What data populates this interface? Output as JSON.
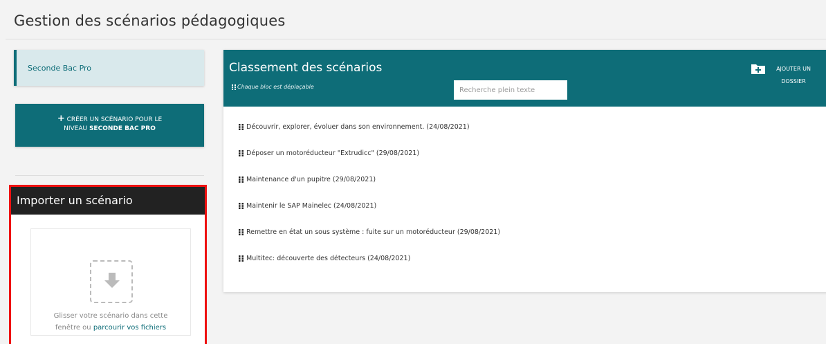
{
  "page": {
    "title": "Gestion des scénarios pédagogiques"
  },
  "sidebar": {
    "level_tab": "Seconde Bac Pro",
    "create_button": {
      "plus": "+",
      "line1": "CRÉER UN SCÉNARIO POUR LE",
      "line2_prefix": "NIVEAU ",
      "line2_bold": "SECONDE BAC PRO"
    }
  },
  "import": {
    "title": "Importer un scénario",
    "drop_line1": "Glisser votre scénario dans cette",
    "drop_line2_prefix": "fenêtre ou ",
    "drop_link": "parcourir vos fichiers"
  },
  "classement": {
    "title": "Classement des scénarios",
    "hint": "Chaque bloc est déplaçable",
    "search_placeholder": "Recherche plein texte",
    "add_folder": {
      "line1": "AJOUTER UN",
      "line2": "DOSSIER"
    },
    "items": [
      "Découvrir, explorer, évoluer dans son environnement. (24/08/2021)",
      "Déposer un motoréducteur \"Extrudicc\" (29/08/2021)",
      "Maintenance d'un pupitre (29/08/2021)",
      "Maintenir le SAP Mainelec (24/08/2021)",
      "Remettre en état un sous système : fuite sur un motoréducteur (29/08/2021)",
      "Multitec: découverte des détecteurs (24/08/2021)"
    ]
  },
  "colors": {
    "accent": "#0e6d78",
    "import_header": "#222222",
    "highlight_border": "#ee1111"
  },
  "icons": {
    "folder_add": "folder-plus-icon",
    "download": "download-arrow-icon",
    "grip": "drag-grip-icon"
  }
}
